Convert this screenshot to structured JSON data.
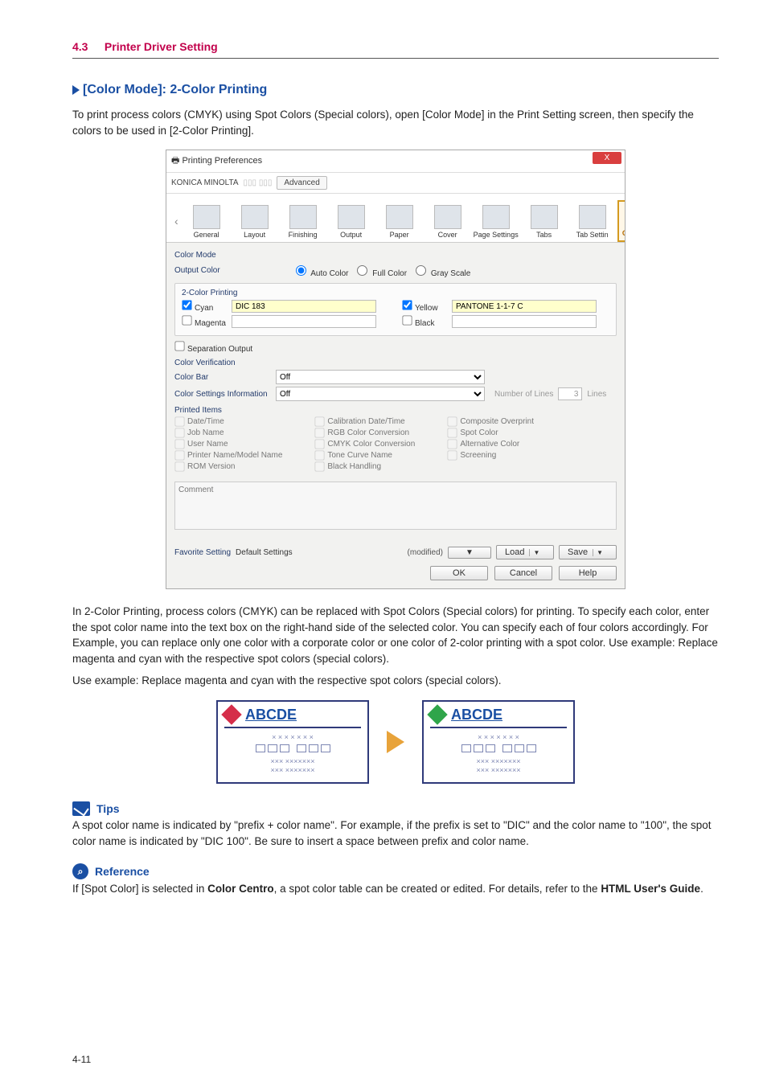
{
  "header": {
    "section_number": "4.3",
    "section_title": "Printer Driver Setting"
  },
  "topic": {
    "heading": "[Color Mode]: 2-Color Printing"
  },
  "intro": "To print process colors (CMYK) using Spot Colors (Special colors), open [Color Mode] in the Print Setting screen, then specify the colors to be used in [2-Color Printing].",
  "dialog": {
    "title": "Printing Preferences",
    "close": "X",
    "brand": "KONICA MINOLTA",
    "brand_tab": "Advanced",
    "tabs": {
      "prev": "‹",
      "next": "›",
      "items": [
        {
          "label": "General"
        },
        {
          "label": "Layout"
        },
        {
          "label": "Finishing"
        },
        {
          "label": "Output"
        },
        {
          "label": "Paper"
        },
        {
          "label": "Cover"
        },
        {
          "label": "Page Settings"
        },
        {
          "label": "Tabs"
        },
        {
          "label": "Tab Settin"
        },
        {
          "label": "Color Mode"
        }
      ]
    },
    "color_mode_label": "Color Mode",
    "output_color": {
      "label": "Output Color",
      "opts": [
        "Auto Color",
        "Full Color",
        "Gray Scale"
      ]
    },
    "two_color": {
      "group": "2-Color Printing",
      "cyan": {
        "label": "Cyan",
        "value": "DIC 183"
      },
      "yellow": {
        "label": "Yellow",
        "value": "PANTONE 1-1-7 C"
      },
      "magenta": {
        "label": "Magenta",
        "value": ""
      },
      "black": {
        "label": "Black",
        "value": ""
      }
    },
    "separation_output": "Separation Output",
    "color_verification": "Color Verification",
    "color_bar": {
      "label": "Color Bar",
      "value": "Off"
    },
    "csi": {
      "label": "Color Settings Information",
      "value": "Off",
      "num_label": "Number of Lines",
      "num_unit": "Lines",
      "num_value": "3"
    },
    "printed_items": {
      "label": "Printed Items",
      "col1": [
        "Date/Time",
        "Job Name",
        "User Name",
        "Printer Name/Model Name",
        "ROM Version"
      ],
      "col2": [
        "Calibration Date/Time",
        "RGB Color Conversion",
        "CMYK Color Conversion",
        "Tone Curve Name",
        "Black Handling"
      ],
      "col3": [
        "Composite Overprint",
        "Spot Color",
        "Alternative Color",
        "Screening"
      ]
    },
    "comment_placeholder": "Comment",
    "favorite": {
      "label": "Favorite Setting",
      "value": "Default Settings",
      "modified": "(modified)",
      "drop": "▼",
      "load": "Load",
      "save": "Save"
    },
    "footer": {
      "ok": "OK",
      "cancel": "Cancel",
      "help": "Help"
    }
  },
  "after_screenshot": "In 2-Color Printing, process colors (CMYK) can be replaced with Spot Colors (Special colors) for printing. To specify each color, enter the spot color name into the text box on the right-hand side of the selected color. You can specify each of four colors accordingly. For Example, you can replace only one color with a corporate color or one color of 2-color printing with a spot color. Use example: Replace magenta and cyan with the respective spot colors (special colors).",
  "use_example": "Use example: Replace magenta and cyan with the respective spot colors (special colors).",
  "example_card": {
    "title": "ABCDE",
    "line1": "× × × × × × ×",
    "line3": "××× ×××××××",
    "line4": "××× ×××××××"
  },
  "tips": {
    "label": "Tips",
    "text": "A spot color name is indicated by \"prefix + color name\". For example, if the prefix is set to \"DIC\" and the color name to \"100\", the spot color name is indicated by \"DIC 100\". Be sure to insert a space between prefix and color name."
  },
  "reference": {
    "label": "Reference",
    "pre": "If [Spot Color] is selected in ",
    "b1": "Color Centro",
    "mid": ", a spot color table can be created or edited. For details, refer to the ",
    "b2": "HTML User's Guide",
    "post": "."
  },
  "page_number": "4-11"
}
